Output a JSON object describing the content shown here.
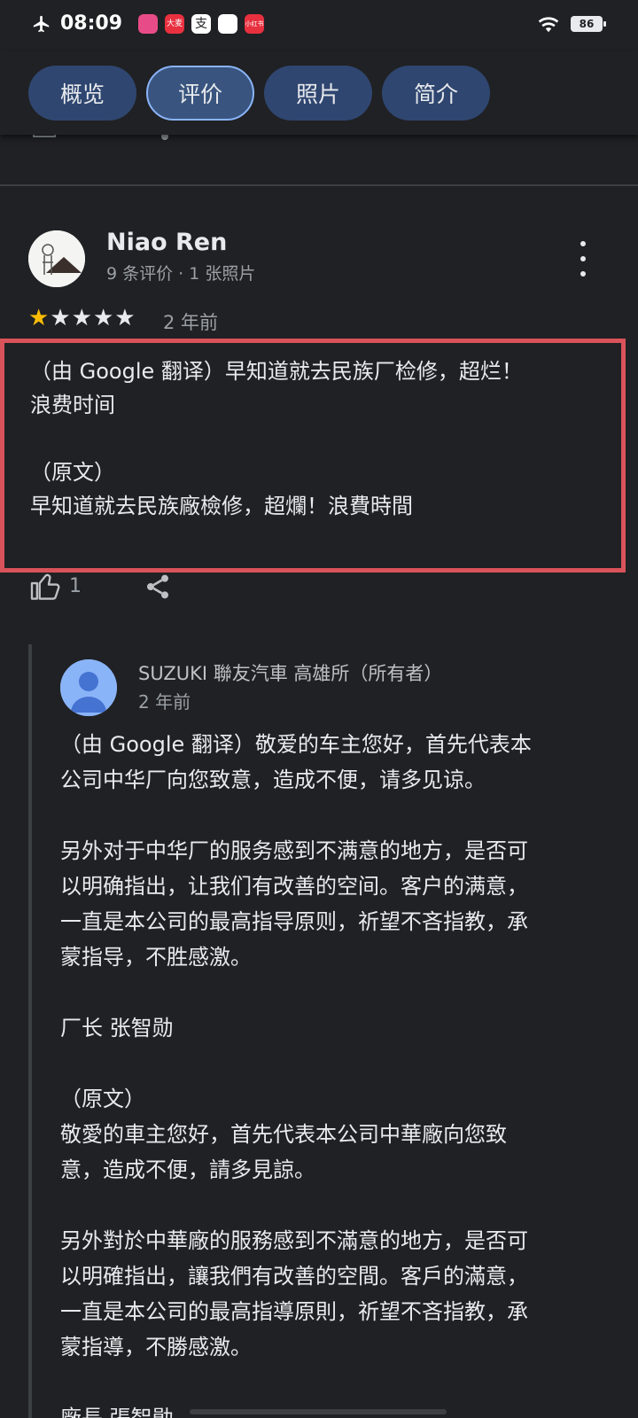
{
  "status_bar": {
    "time": "08:09",
    "battery": "86",
    "apps": [
      {
        "icon": "app-icon-1",
        "label": "",
        "color": "#e84c88"
      },
      {
        "icon": "app-icon-2",
        "label": "大麦",
        "color": "#e8303f"
      },
      {
        "icon": "app-icon-3",
        "label": "支",
        "color": "#ffffff"
      },
      {
        "icon": "app-icon-4",
        "label": "",
        "color": "#ffffff"
      },
      {
        "icon": "app-icon-5",
        "label": "小红书",
        "color": "#e8303f"
      }
    ]
  },
  "tabs": [
    {
      "label": "概览",
      "active": false
    },
    {
      "label": "评价",
      "active": true
    },
    {
      "label": "照片",
      "active": false
    },
    {
      "label": "简介",
      "active": false
    }
  ],
  "review": {
    "author": "Niao Ren",
    "meta": "9 条评价 · 1 张照片",
    "rating": 1,
    "max_rating": 5,
    "time": "2 年前",
    "text_lines": [
      "（由 Google 翻译）早知道就去民族厂检修，超烂！",
      "浪费时间",
      "",
      "（原文）",
      "早知道就去民族廠檢修，超爛！浪費時間"
    ],
    "likes": "1"
  },
  "reply": {
    "owner": "SUZUKI 聯友汽車 高雄所（所有者）",
    "time": "2 年前",
    "text_lines": [
      "（由 Google 翻译）敬爱的车主您好，首先代表本",
      "公司中华厂向您致意，造成不便，请多见谅。",
      "",
      "另外对于中华厂的服务感到不满意的地方，是否可",
      "以明确指出，让我们有改善的空间。客户的满意，",
      "一直是本公司的最高指导原则，祈望不吝指教，承",
      "蒙指导，不胜感激。",
      "",
      "厂长 张智勋",
      "",
      "（原文）",
      "敬愛的車主您好，首先代表本公司中華廠向您致",
      "意，造成不便，請多見諒。",
      "",
      "另外對於中華廠的服務感到不滿意的地方，是否可",
      "以明確指出，讓我們有改善的空間。客戶的滿意，",
      "一直是本公司的最高指導原則，祈望不吝指教，承",
      "蒙指導，不勝感激。",
      "",
      "廠長 張智勛"
    ]
  },
  "colors": {
    "background": "#202124",
    "tab": "#2f4670",
    "tab_active_border": "#8ab4f8",
    "star_filled": "#fbbc04",
    "star_empty": "#e8eaed",
    "highlight": "#d9535b"
  }
}
